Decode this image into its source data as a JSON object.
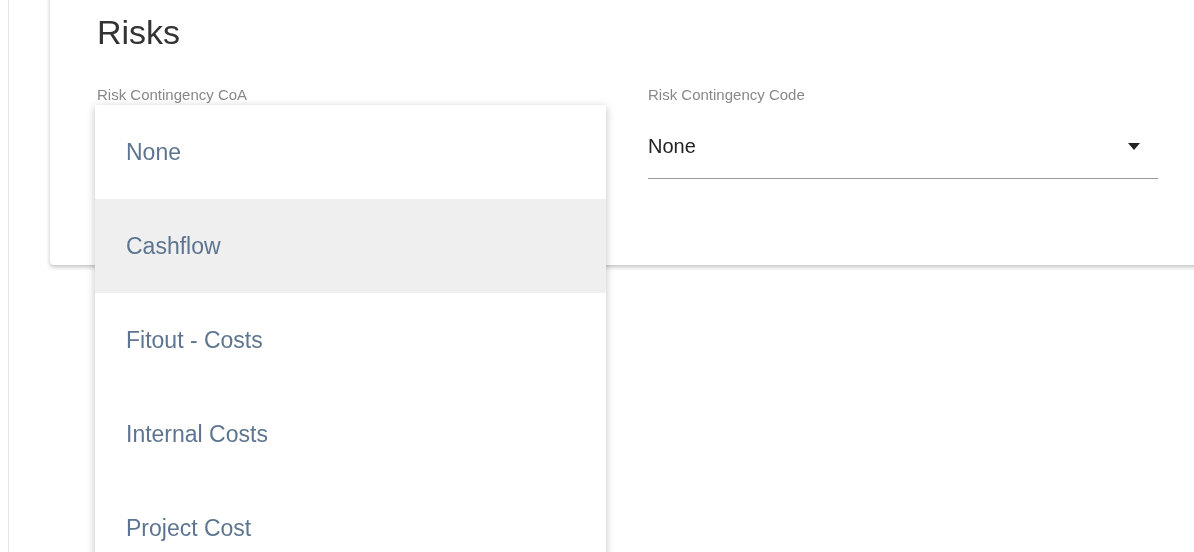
{
  "card": {
    "title": "Risks"
  },
  "fields": [
    {
      "label": "Risk Contingency CoA"
    },
    {
      "label": "Risk Contingency Code",
      "value": "None"
    }
  ],
  "dropdown": {
    "options": [
      {
        "label": "None",
        "highlighted": false
      },
      {
        "label": "Cashflow",
        "highlighted": true
      },
      {
        "label": "Fitout - Costs",
        "highlighted": false
      },
      {
        "label": "Internal Costs",
        "highlighted": false
      },
      {
        "label": "Project Cost",
        "highlighted": false
      }
    ]
  }
}
